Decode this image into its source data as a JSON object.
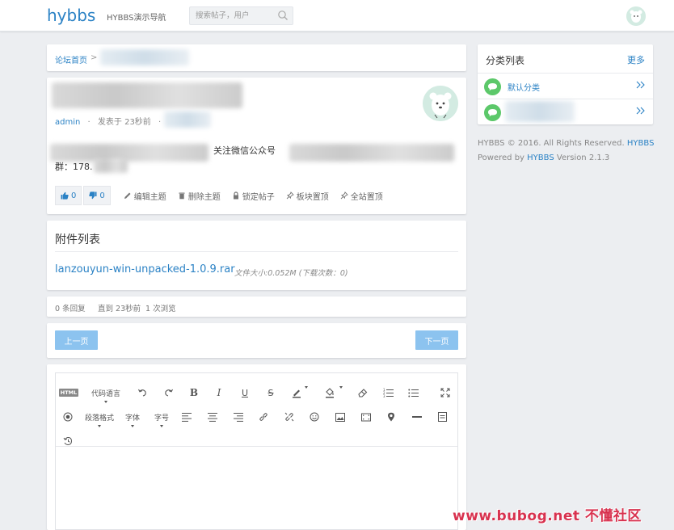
{
  "header": {
    "logo": "hybbs",
    "nav_link": "HYBBS演示导航",
    "search_placeholder": "搜索帖子，用户"
  },
  "breadcrumb": {
    "home": "论坛首页",
    "sep": ">"
  },
  "post": {
    "author": "admin",
    "dot1": "·",
    "posted": "发表于 23秒前",
    "dot2": "·",
    "line1_mid": "关注微信公众号",
    "line2": "群：178.",
    "likes": "0",
    "dislikes": "0",
    "actions": {
      "edit": "编辑主题",
      "delete": "删除主题",
      "lock": "锁定帖子",
      "pin_board": "板块置顶",
      "pin_all": "全站置顶"
    }
  },
  "attachments": {
    "title": "附件列表",
    "file_name": "lanzouyun-win-unpacked-1.0.9.rar",
    "file_info": "文件大小:0.052M (下载次数：0)"
  },
  "stats": {
    "replies": "0 条回复",
    "until": "直到 23秒前",
    "views": "1 次浏览"
  },
  "pager": {
    "prev": "上一页",
    "next": "下一页"
  },
  "editor": {
    "html_btn": "HTML",
    "code_lang": "代码语言",
    "paragraph": "段落格式",
    "font": "字体",
    "font_size": "字号"
  },
  "sidebar": {
    "title": "分类列表",
    "more": "更多",
    "categories": [
      {
        "label": "默认分类"
      }
    ],
    "footer_line1_a": "HYBBS © 2016. All Rights Reserved.",
    "footer_line1_b": "HYBBS",
    "footer_line2_a": "Powered by",
    "footer_line2_b": "HYBBS",
    "footer_line2_c": "Version 2.1.3"
  },
  "watermark": "www.bubog.net 不懂社区",
  "colors": {
    "accent": "#2b82c5",
    "button": "#8cc3ef",
    "category_bubble": "#5cc86a",
    "watermark": "#d8324f"
  }
}
